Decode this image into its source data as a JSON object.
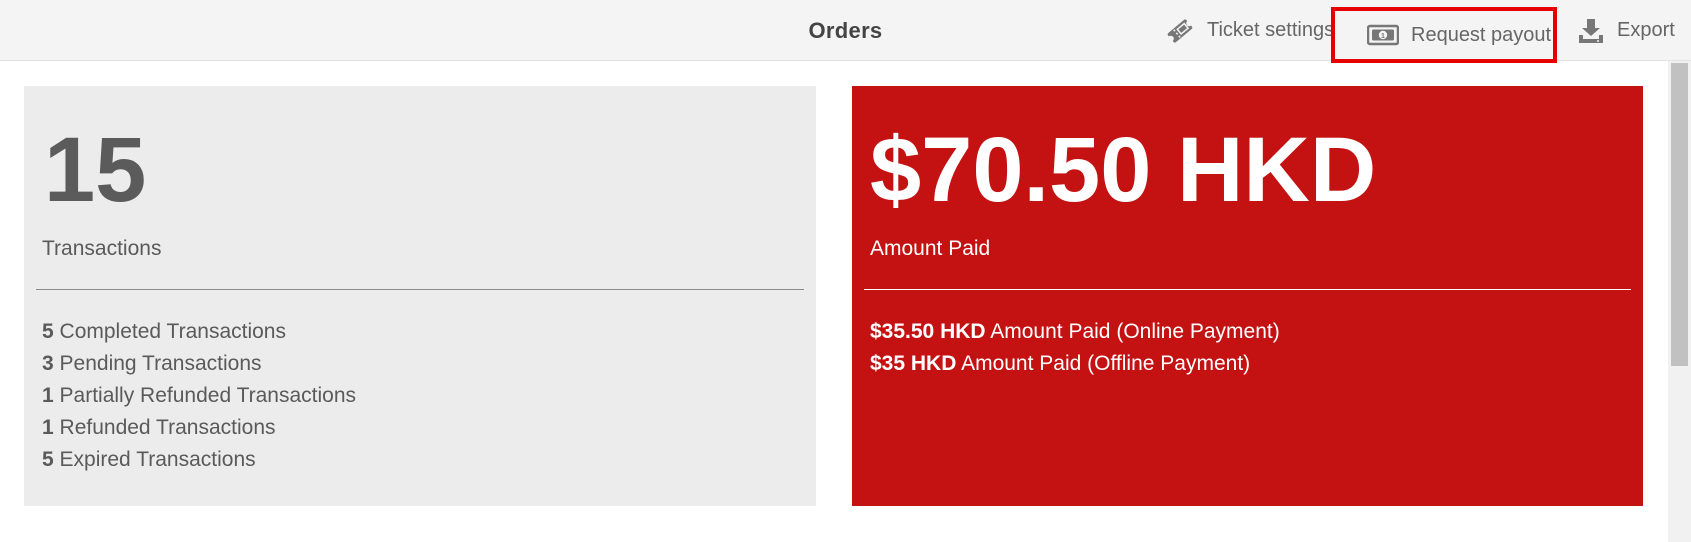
{
  "header": {
    "title": "Orders",
    "ticket_settings_label": "Ticket settings",
    "request_payout_label": "Request payout",
    "export_label": "Export",
    "icons": {
      "ticket": "ticket-icon",
      "payout": "money-bill-icon",
      "export": "download-icon"
    },
    "highlight_color": "#e60000"
  },
  "transactions_card": {
    "count": "15",
    "label": "Transactions",
    "stats": [
      {
        "count": "5",
        "label": "Completed Transactions"
      },
      {
        "count": "3",
        "label": "Pending Transactions"
      },
      {
        "count": "1",
        "label": "Partially Refunded Transactions"
      },
      {
        "count": "1",
        "label": "Refunded Transactions"
      },
      {
        "count": "5",
        "label": "Expired Transactions"
      }
    ],
    "background_color": "#ececec"
  },
  "amount_card": {
    "total": "$70.50 HKD",
    "label": "Amount Paid",
    "breakdown": [
      {
        "amount": "$35.50 HKD",
        "label": "Amount Paid (Online Payment)"
      },
      {
        "amount": "$35 HKD",
        "label": "Amount Paid (Offline Payment)"
      }
    ],
    "background_color": "#c41212"
  }
}
